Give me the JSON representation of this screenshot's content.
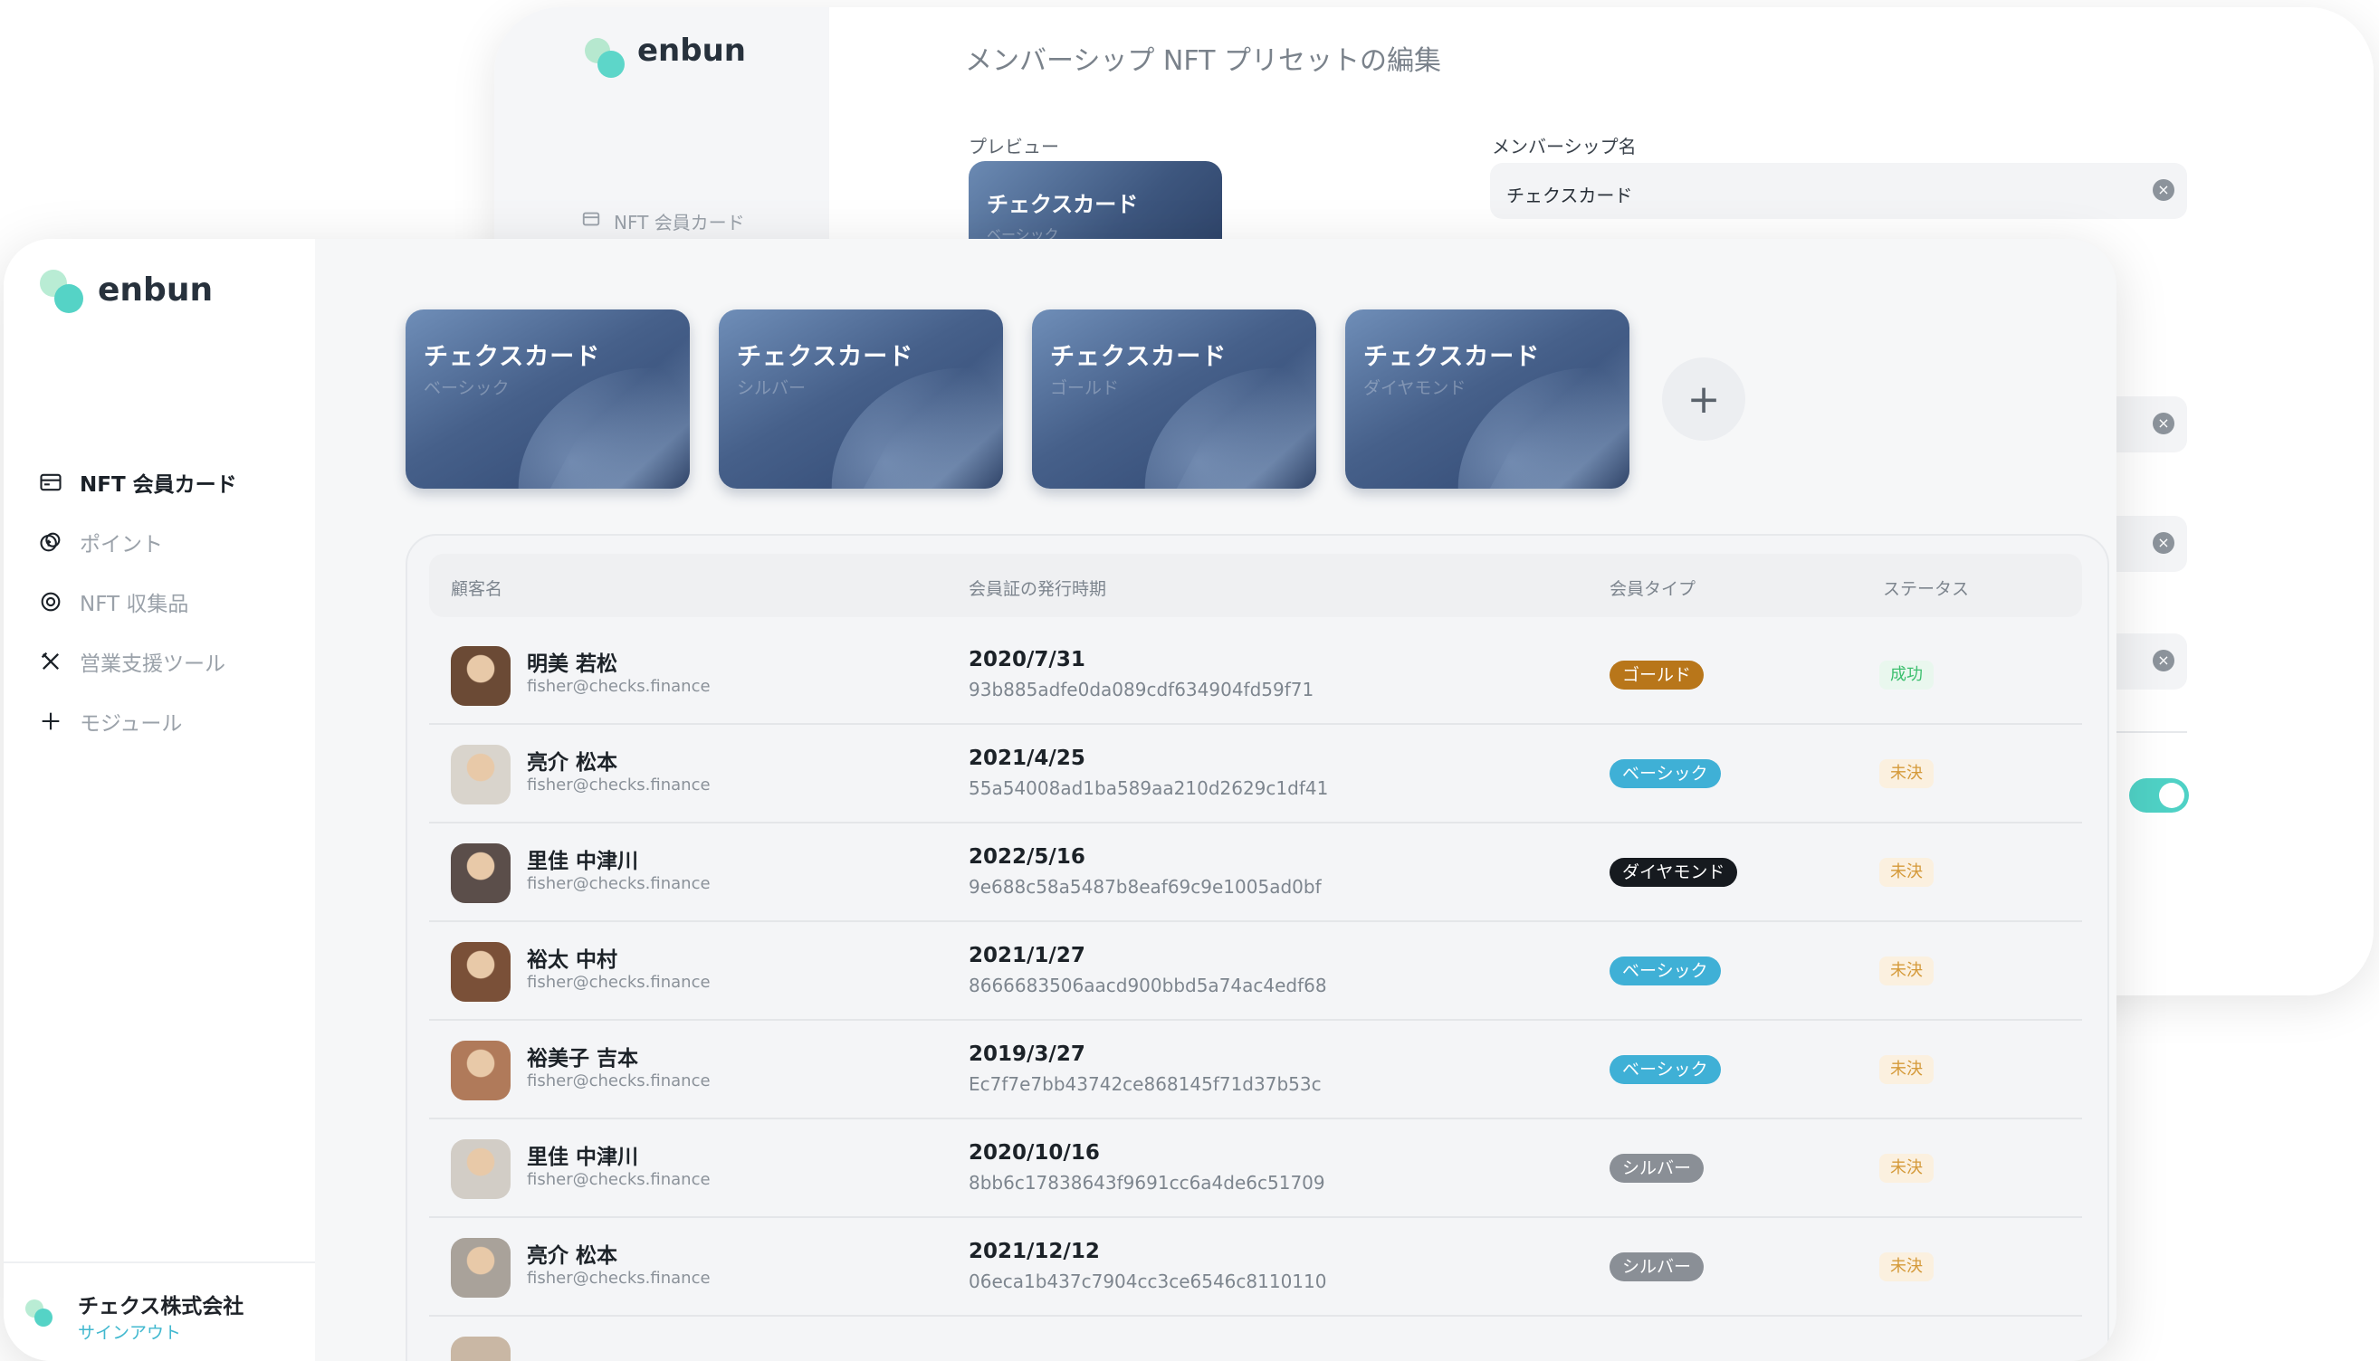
{
  "brand": {
    "name": "enbun"
  },
  "back_window": {
    "title": "メンバーシップ NFT プリセットの編集",
    "nav_label": "NFT 会員カード",
    "preview_label": "プレビュー",
    "preview_card": {
      "title": "チェクスカード",
      "subtitle": "ベーシック"
    },
    "name_label": "メンバーシップ名",
    "name_value": "チェクスカード",
    "toggle_on": true
  },
  "sidebar": {
    "items": [
      {
        "label": "NFT 会員カード",
        "icon": "card-icon",
        "active": true
      },
      {
        "label": "ポイント",
        "icon": "coins-icon",
        "active": false
      },
      {
        "label": "NFT 収集品",
        "icon": "target-icon",
        "active": false
      },
      {
        "label": "営業支援ツール",
        "icon": "tools-icon",
        "active": false
      },
      {
        "label": "モジュール",
        "icon": "plus-icon",
        "active": false
      }
    ],
    "company": {
      "name": "チェクス株式会社",
      "signout": "サインアウト"
    }
  },
  "cards": [
    {
      "title": "チェクスカード",
      "subtitle": "ベーシック"
    },
    {
      "title": "チェクスカード",
      "subtitle": "シルバー"
    },
    {
      "title": "チェクスカード",
      "subtitle": "ゴールド"
    },
    {
      "title": "チェクスカード",
      "subtitle": "ダイヤモンド"
    }
  ],
  "add_card_symbol": "+",
  "table": {
    "headers": {
      "customer": "顧客名",
      "issued": "会員証の発行時期",
      "type": "会員タイプ",
      "status": "ステータス"
    },
    "rows": [
      {
        "name": "明美 若松",
        "email": "fisher@checks.finance",
        "date": "2020/7/31",
        "hash": "93b885adfe0da089cdf634904fd59f71",
        "type": "ゴールド",
        "type_color": "#b8761a",
        "status": "成功",
        "status_kind": "success",
        "avatar_tone": "#6b4a35"
      },
      {
        "name": "亮介 松本",
        "email": "fisher@checks.finance",
        "date": "2021/4/25",
        "hash": "55a54008ad1ba589aa210d2629c1df41",
        "type": "ベーシック",
        "type_color": "#3fb0d6",
        "status": "未決",
        "status_kind": "pending",
        "avatar_tone": "#d9d4cc"
      },
      {
        "name": "里佳 中津川",
        "email": "fisher@checks.finance",
        "date": "2022/5/16",
        "hash": "9e688c58a5487b8eaf69c9e1005ad0bf",
        "type": "ダイヤモンド",
        "type_color": "#161a1f",
        "status": "未決",
        "status_kind": "pending",
        "avatar_tone": "#5b4e4a"
      },
      {
        "name": "裕太 中村",
        "email": "fisher@checks.finance",
        "date": "2021/1/27",
        "hash": "8666683506aacd900bbd5a74ac4edf68",
        "type": "ベーシック",
        "type_color": "#3fb0d6",
        "status": "未決",
        "status_kind": "pending",
        "avatar_tone": "#7a5038"
      },
      {
        "name": "裕美子 吉本",
        "email": "fisher@checks.finance",
        "date": "2019/3/27",
        "hash": "Ec7f7e7bb43742ce868145f71d37b53c",
        "type": "ベーシック",
        "type_color": "#3fb0d6",
        "status": "未決",
        "status_kind": "pending",
        "avatar_tone": "#b07a5a"
      },
      {
        "name": "里佳 中津川",
        "email": "fisher@checks.finance",
        "date": "2020/10/16",
        "hash": "8bb6c17838643f9691cc6a4de6c51709",
        "type": "シルバー",
        "type_color": "#8a8f96",
        "status": "未決",
        "status_kind": "pending",
        "avatar_tone": "#d2cdc6"
      },
      {
        "name": "亮介 松本",
        "email": "fisher@checks.finance",
        "date": "2021/12/12",
        "hash": "06eca1b437c7904cc3ce6546c8110110",
        "type": "シルバー",
        "type_color": "#8a8f96",
        "status": "未決",
        "status_kind": "pending",
        "avatar_tone": "#a9a29a"
      }
    ]
  },
  "colors": {
    "accent": "#4fd1c5",
    "success_bg": "#e9f7ee",
    "success_fg": "#3cbf6e",
    "pending_bg": "#fbf0df",
    "pending_fg": "#d59a3a"
  }
}
